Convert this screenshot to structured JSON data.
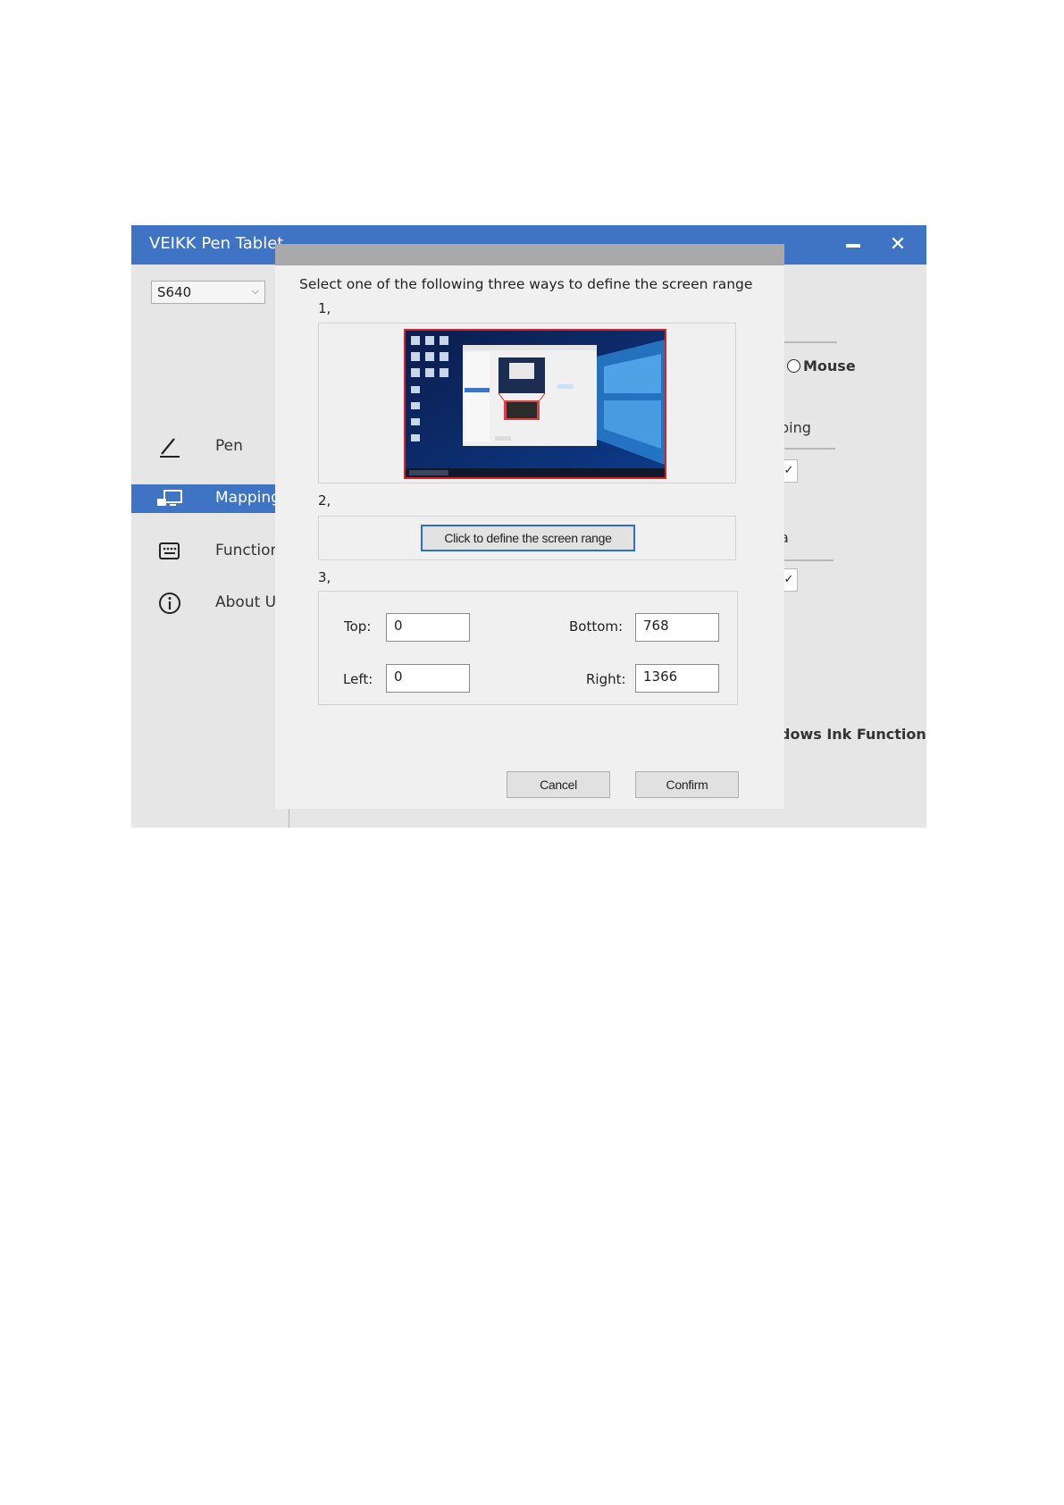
{
  "window": {
    "title": "VEIKK Pen Tablet",
    "minimize_label": "",
    "close_symbol": "✕"
  },
  "device": {
    "selected": "S640"
  },
  "sidebar": {
    "items": [
      {
        "label": "Pen",
        "icon": "pen-icon",
        "active": false
      },
      {
        "label": "Mapping",
        "icon": "monitor-icon",
        "active": true
      },
      {
        "label": "Function",
        "icon": "keyboard-icon",
        "active": false
      },
      {
        "label": "About Us",
        "icon": "info-icon",
        "active": false
      }
    ]
  },
  "background_panel": {
    "mouse_label": "Mouse",
    "mapping_fragment": "ping",
    "area_fragment": "a",
    "check_mark": "✓",
    "ink_fragment": "dows Ink Function"
  },
  "dialog": {
    "instruction": "Select one of the following three ways to define the screen range",
    "step1": "1,",
    "step2": "2,",
    "step3": "3,",
    "define_button": "Click to define the screen range",
    "fields": {
      "top_label": "Top:",
      "top_value": "0",
      "bottom_label": "Bottom:",
      "bottom_value": "768",
      "left_label": "Left:",
      "left_value": "0",
      "right_label": "Right:",
      "right_value": "1366"
    },
    "cancel": "Cancel",
    "confirm": "Confirm"
  },
  "colors": {
    "accent": "#3f73c4",
    "dialog_title": "#a9a9a9",
    "preview_border": "#d6232a"
  }
}
